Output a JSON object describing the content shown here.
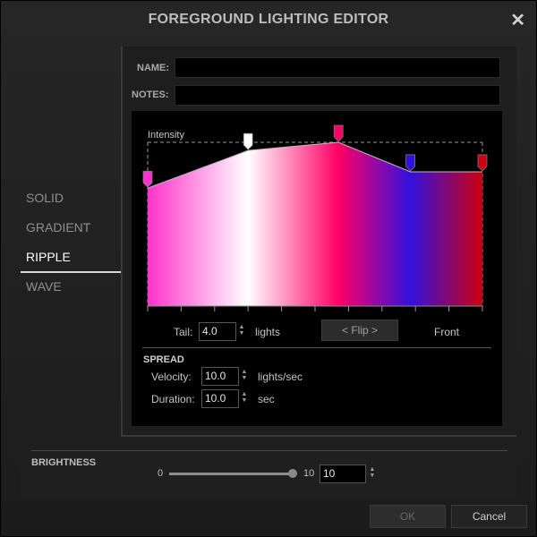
{
  "dialog": {
    "title": "FOREGROUND LIGHTING EDITOR",
    "close_symbol": "✕"
  },
  "sidebar": {
    "items": [
      {
        "label": "SOLID"
      },
      {
        "label": "GRADIENT"
      },
      {
        "label": "RIPPLE"
      },
      {
        "label": "WAVE"
      }
    ],
    "active": "RIPPLE"
  },
  "fields": {
    "name_label": "NAME:",
    "name_value": "",
    "notes_label": "NOTES:",
    "notes_value": ""
  },
  "graph": {
    "label": "Intensity",
    "stops": [
      {
        "pos": 0.0,
        "color": "#ff33cc",
        "level": 0.72
      },
      {
        "pos": 0.3,
        "color": "#ffffff",
        "level": 0.95
      },
      {
        "pos": 0.57,
        "color": "#ff0066",
        "level": 1.0
      },
      {
        "pos": 0.785,
        "color": "#3311dd",
        "level": 0.82
      },
      {
        "pos": 1.0,
        "color": "#cc0011",
        "level": 0.82
      }
    ]
  },
  "tail": {
    "label": "Tail:",
    "value": "4.0",
    "unit": "lights",
    "flip_label": "< Flip >",
    "front_label": "Front"
  },
  "spread": {
    "title": "SPREAD",
    "velocity_label": "Velocity:",
    "velocity_value": "10.0",
    "velocity_unit": "lights/sec",
    "duration_label": "Duration:",
    "duration_value": "10.0",
    "duration_unit": "sec"
  },
  "brightness": {
    "title": "BRIGHTNESS",
    "min_label": "0",
    "max_label": "10",
    "value": "10",
    "level": 1.0
  },
  "footer": {
    "ok_label": "OK",
    "cancel_label": "Cancel"
  },
  "colors": {
    "accent": "#ff0066",
    "text": "#bdbdbd"
  }
}
